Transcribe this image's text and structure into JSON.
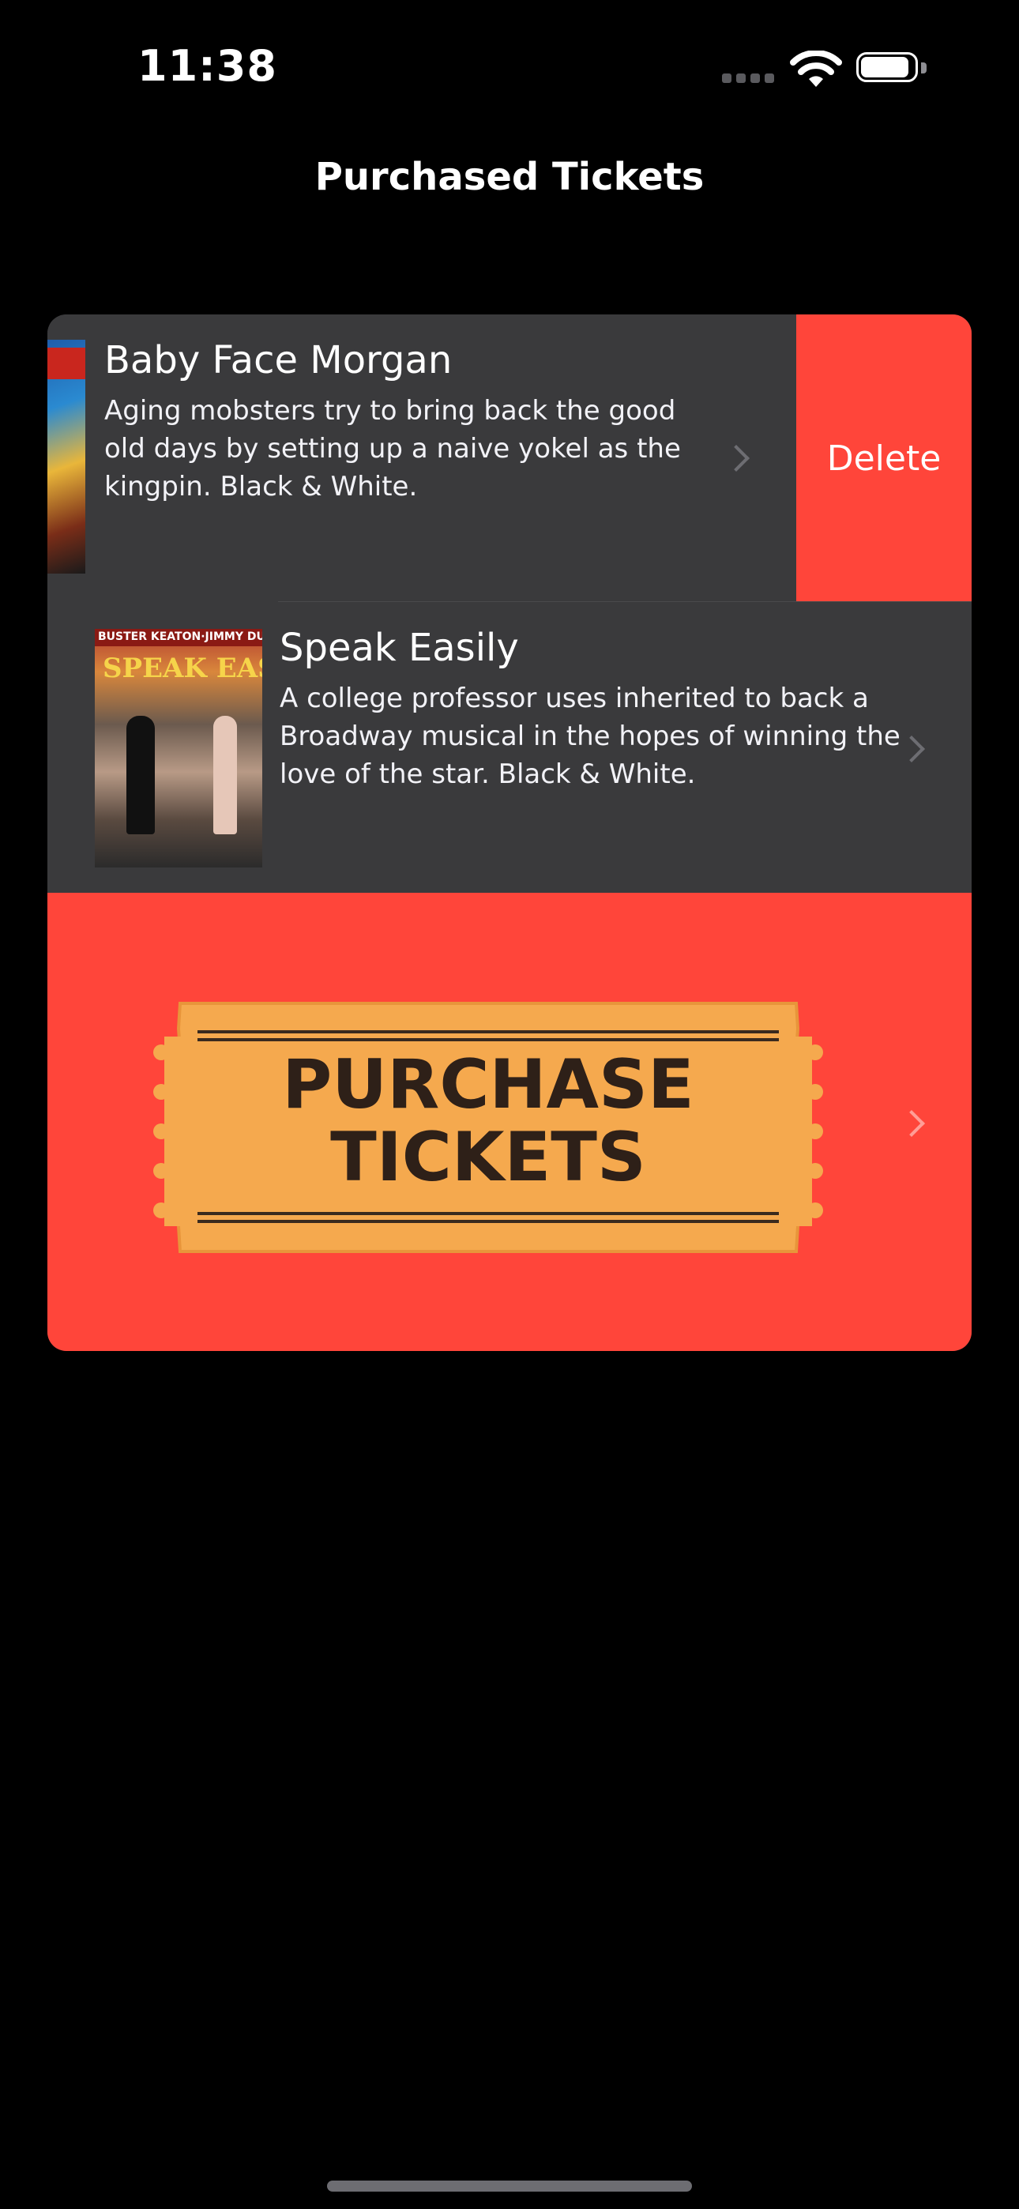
{
  "status_bar": {
    "time": "11:38"
  },
  "nav": {
    "title": "Purchased Tickets"
  },
  "tickets": [
    {
      "title": "Baby Face Morgan",
      "description": "Aging mobsters try to bring back the good old days by setting up a naive yokel as the kingpin. Black & White.",
      "delete_label": "Delete"
    },
    {
      "title": "Speak Easily",
      "description": "A college professor uses inherited to back a Broadway musical in the hopes of winning the love of the star. Black & White.",
      "poster_credits": "BUSTER KEATON·JIMMY DURANTE",
      "poster_title": "SPEAK EASILY"
    }
  ],
  "purchase": {
    "line1": "PURCHASE",
    "line2": "TICKETS"
  },
  "colors": {
    "delete": "#ff453a",
    "row_bg": "#3a3a3c",
    "ticket": "#f5a94e"
  }
}
